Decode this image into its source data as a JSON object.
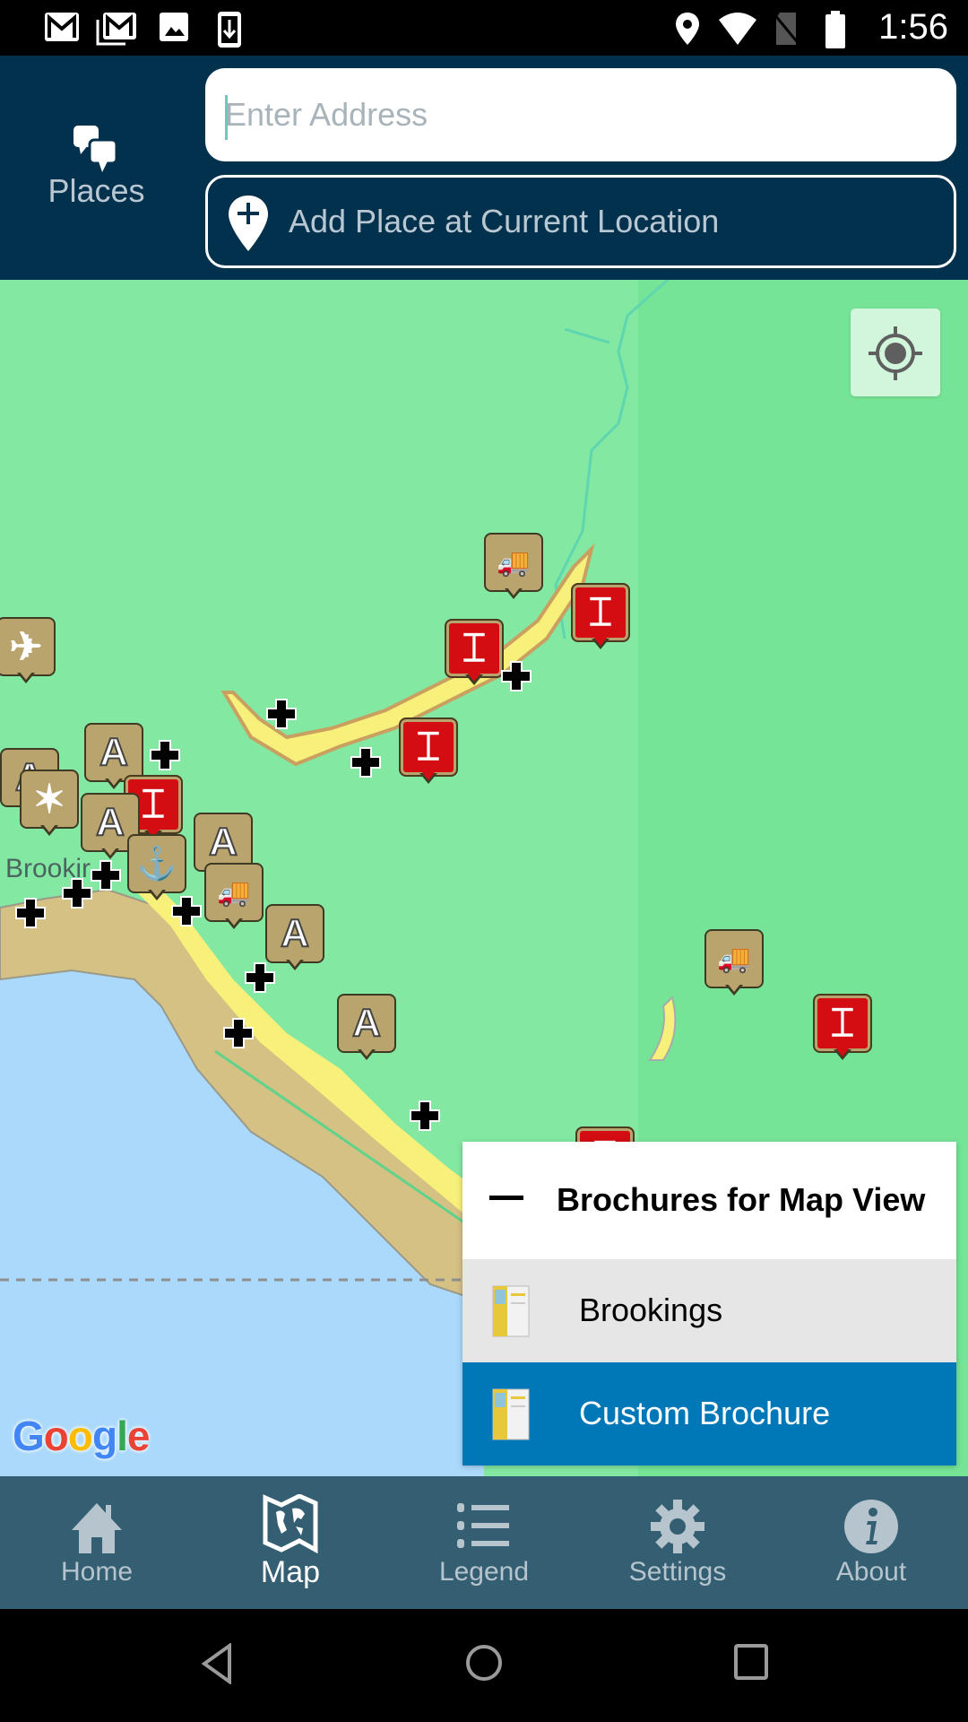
{
  "status_bar": {
    "time": "1:56",
    "left_icons": [
      "gmail-icon",
      "gmail-stack-icon",
      "image-icon",
      "download-icon"
    ],
    "right_icons": [
      "location-icon",
      "wifi-icon",
      "no-sim-icon",
      "battery-icon"
    ]
  },
  "header": {
    "places_label": "Places",
    "address_placeholder": "Enter Address",
    "address_value": "",
    "add_place_label": "Add Place at Current Location"
  },
  "map": {
    "town_label": "Brookir",
    "attribution": "Google",
    "locate_button": "my-location-icon",
    "colors": {
      "forest": "#7be59c",
      "water": "#abd9fb",
      "land": "#d5c184",
      "urban": "#f7f07a",
      "marker_tan": "#b9a46e",
      "marker_red": "#d40d12"
    }
  },
  "brochures": {
    "title": "Brochures for Map View",
    "items": [
      {
        "label": "Brookings",
        "selected": false
      },
      {
        "label": "Custom Brochure",
        "selected": true
      }
    ],
    "selected_color": "#0077b6"
  },
  "tabs": [
    {
      "label": "Home",
      "icon": "home-icon",
      "active": false
    },
    {
      "label": "Map",
      "icon": "map-icon",
      "active": true
    },
    {
      "label": "Legend",
      "icon": "list-icon",
      "active": false
    },
    {
      "label": "Settings",
      "icon": "gear-icon",
      "active": false
    },
    {
      "label": "About",
      "icon": "info-icon",
      "active": false
    }
  ]
}
